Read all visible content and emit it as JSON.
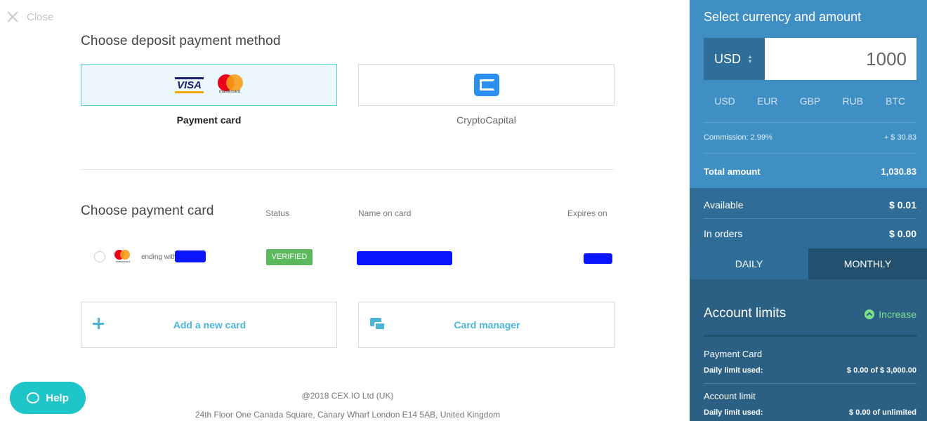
{
  "close": {
    "label": "Close"
  },
  "deposit": {
    "title": "Choose deposit payment method",
    "methods": [
      {
        "label": "Payment card",
        "visa": "VISA",
        "mastercard": "mastercard"
      },
      {
        "label": "CryptoCapital"
      }
    ]
  },
  "cards": {
    "title": "Choose payment card",
    "columns": {
      "status": "Status",
      "name": "Name on card",
      "expires": "Expires on"
    },
    "row": {
      "brand": "mastercard",
      "ending": "ending with",
      "status": "VERIFIED"
    }
  },
  "actions": {
    "add_card": "Add a new card",
    "card_manager": "Card manager"
  },
  "footer": {
    "copyright": "@2018 CEX.IO Ltd (UK)",
    "address": "24th Floor One Canada Square, Canary Wharf London E14 5AB, United Kingdom"
  },
  "help": {
    "label": "Help"
  },
  "panel": {
    "title": "Select currency and amount",
    "currency": "USD",
    "amount": "1000",
    "currency_tabs": [
      "USD",
      "EUR",
      "GBP",
      "RUB",
      "BTC"
    ],
    "commission_label": "Commission: 2.99%",
    "commission_value": "+ $ 30.83",
    "total_label": "Total amount",
    "total_value": "1,030.83",
    "available_label": "Available",
    "available_value": "$ 0.01",
    "in_orders_label": "In orders",
    "in_orders_value": "$ 0.00",
    "period_tabs": {
      "daily": "DAILY",
      "monthly": "MONTHLY"
    },
    "limits_title": "Account limits",
    "increase_label": "Increase",
    "limits": [
      {
        "name": "Payment Card",
        "sub": "Daily limit used:",
        "value": "$ 0.00 of $ 3,000.00"
      },
      {
        "name": "Account limit",
        "sub": "Daily limit used:",
        "value": "$ 0.00 of unlimited"
      }
    ]
  },
  "colors": {
    "accent": "#4ab5d9",
    "panel": "#3f8fc4",
    "panel_dark": "#2b5f84",
    "verified": "#5cb85c",
    "help": "#1fc6c9",
    "increase": "#7ee08a"
  }
}
